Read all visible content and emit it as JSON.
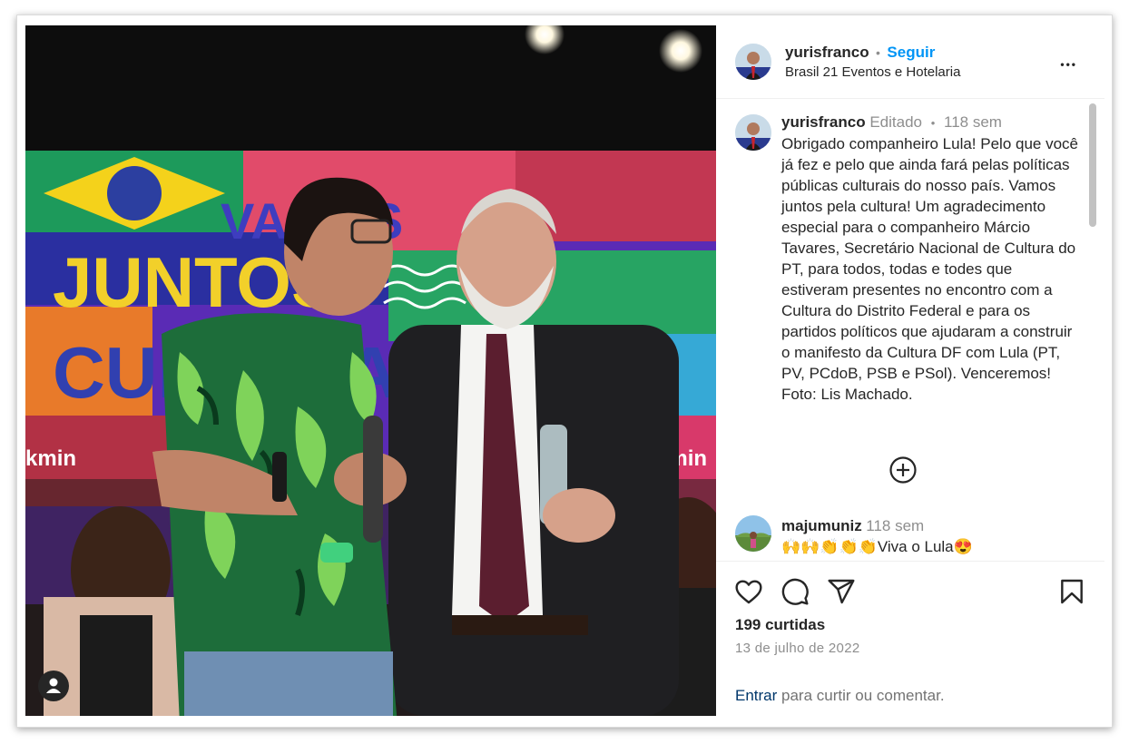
{
  "header": {
    "username": "yurisfranco",
    "separator": "•",
    "follow_label": "Seguir",
    "location": "Brasil 21 Eventos e Hotelaria",
    "more_label": "•••"
  },
  "caption": {
    "username": "yurisfranco",
    "edited": "Editado",
    "separator": "•",
    "time": "118 sem",
    "text": "Obrigado companheiro Lula! Pelo que você já fez e pelo que ainda fará pelas políticas públicas culturais do nosso país. Vamos juntos pela cultura! Um agradecimento especial para o companheiro Márcio Tavares, Secretário Nacional de Cultura do PT, para todos, todas e todes que estiveram presentes no encontro com a Cultura do Distrito Federal e para os partidos políticos que ajudaram a construir o manifesto da Cultura DF com Lula (PT, PV, PCdoB, PSB e PSol). Venceremos! Foto: Lis Machado."
  },
  "comment": {
    "username": "majumuniz",
    "time": "118 sem",
    "text": "🙌🙌👏👏👏Viva o Lula😍"
  },
  "photo": {
    "banner_text_1": "VAMOS",
    "banner_text_2": "JUNTOS",
    "banner_text_3": "CULTURA",
    "banner_side_left": "kmin",
    "banner_side_right": "kmin"
  },
  "actions": {
    "likes": "199 curtidas",
    "date": "13 de julho de 2022",
    "login_link": "Entrar",
    "login_text": " para curtir ou comentar."
  },
  "icons": {
    "like": "heart-icon",
    "comment": "comment-icon",
    "share": "paper-plane-icon",
    "save": "bookmark-icon",
    "load_more": "plus-circle-icon",
    "tagged": "user-tag-icon"
  },
  "colors": {
    "follow": "#0095f6",
    "text": "#262626",
    "muted": "#8e8e8e"
  }
}
